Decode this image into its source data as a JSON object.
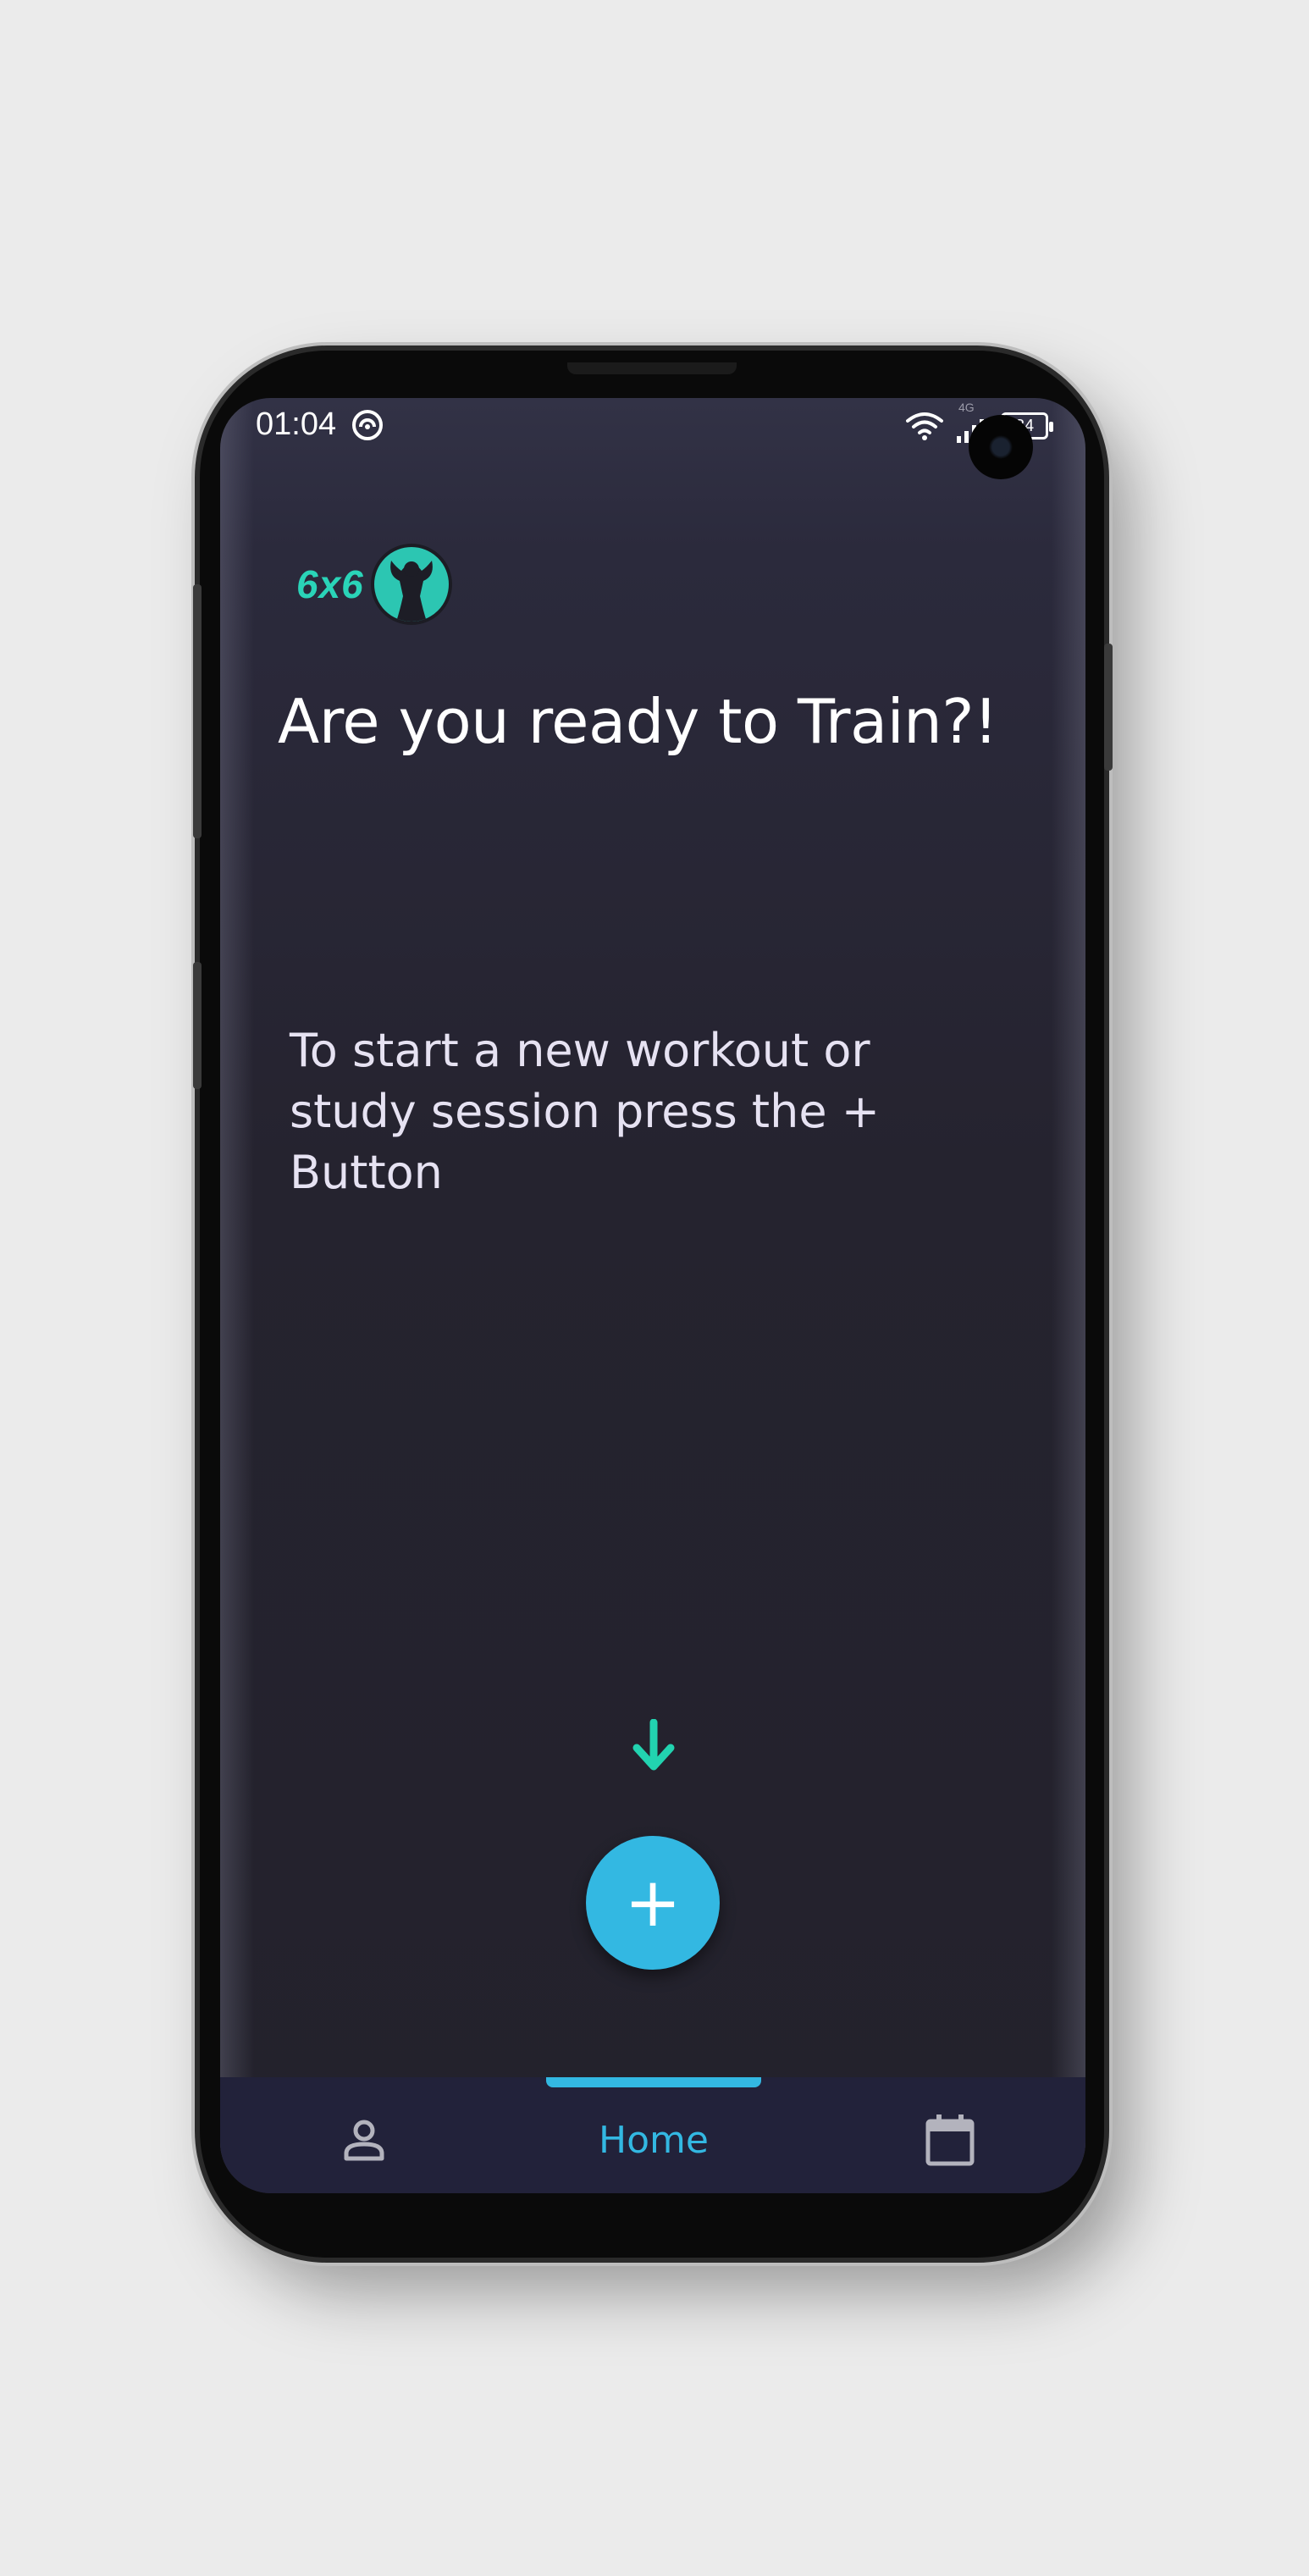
{
  "status_bar": {
    "time": "01:04",
    "network": "4G",
    "battery": "84"
  },
  "app": {
    "logo_text": "6x6",
    "headline": "Are you ready to Train?!",
    "instruction": "To start a new workout or study session press the + Button"
  },
  "fab": {
    "label": "+"
  },
  "bottom_nav": {
    "home_label": "Home"
  },
  "colors": {
    "accent": "#33b8e2",
    "brand": "#2ad4b8",
    "background": "#25232f",
    "nav_background": "#22223a"
  },
  "icons": {
    "status": [
      "do-not-disturb-icon",
      "wifi-icon",
      "signal-icon",
      "battery-icon"
    ],
    "nav": [
      "profile-icon",
      "calendar-icon"
    ],
    "hint": "arrow-down-icon"
  }
}
